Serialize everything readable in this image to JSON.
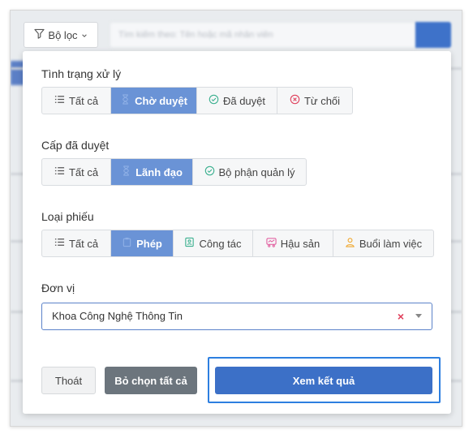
{
  "toolbar": {
    "filter_label": "Bộ lọc",
    "search_placeholder": "Tìm kiếm theo: Tên hoặc mã nhân viên"
  },
  "filter_panel": {
    "status": {
      "label": "Tình trạng xử lý",
      "options": [
        "Tất cả",
        "Chờ duyệt",
        "Đã duyệt",
        "Từ chối"
      ],
      "selected": "Chờ duyệt"
    },
    "approval_level": {
      "label": "Cấp đã duyệt",
      "options": [
        "Tất cả",
        "Lãnh đạo",
        "Bộ phận quản lý"
      ],
      "selected": "Lãnh đạo"
    },
    "ticket_type": {
      "label": "Loại phiếu",
      "options": [
        "Tất cả",
        "Phép",
        "Công tác",
        "Hậu sản",
        "Buổi làm việc"
      ],
      "selected": "Phép"
    },
    "unit": {
      "label": "Đơn vị",
      "value": "Khoa Công Nghệ Thông Tin",
      "clear_symbol": "×"
    },
    "buttons": {
      "exit": "Thoát",
      "clear_all": "Bỏ chọn tất cả",
      "view_results": "Xem kết quả"
    }
  },
  "colors": {
    "active_segment": "#6a93d6",
    "primary": "#3c70c7",
    "secondary": "#6c757d",
    "focus_ring": "#2d7fe0",
    "clear_x": "#e0405c"
  }
}
